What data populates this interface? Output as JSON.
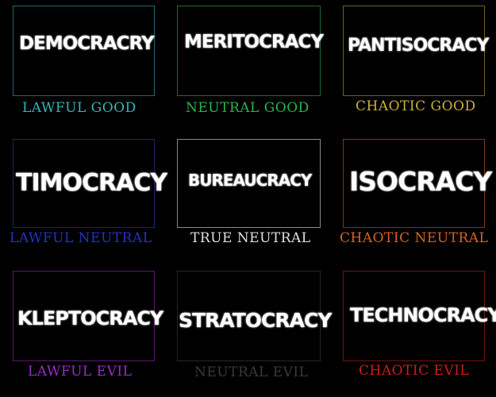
{
  "cells": [
    {
      "word": "DEMOCRACRY",
      "alignment": "LAWFUL GOOD",
      "color": "#2fb7b7",
      "border": "#1e6b6b"
    },
    {
      "word": "MERITOCRACY",
      "alignment": "NEUTRAL GOOD",
      "color": "#28b54a",
      "border": "#1c6a30"
    },
    {
      "word": "PANTISOCRACY",
      "alignment": "CHAOTIC GOOD",
      "color": "#c9b13a",
      "border": "#6e6323"
    },
    {
      "word": "TIMOCRACY",
      "alignment": "LAWFUL NEUTRAL",
      "color": "#2233c4",
      "border": "#1a2470"
    },
    {
      "word": "BUREAUCRACY",
      "alignment": "TRUE NEUTRAL",
      "color": "#e0e0e0",
      "border": "#8a8a8a"
    },
    {
      "word": "ISOCRACY",
      "alignment": "CHAOTIC NEUTRAL",
      "color": "#d9621c",
      "border": "#7a3a14"
    },
    {
      "word": "KLEPTOCRACY",
      "alignment": "LAWFUL EVIL",
      "color": "#9a2cc4",
      "border": "#5a1a72"
    },
    {
      "word": "STRATOCRACY",
      "alignment": "NEUTRAL EVIL",
      "color": "#3a3a3a",
      "border": "#262626"
    },
    {
      "word": "TECHNOCRACY",
      "alignment": "CHAOTIC EVIL",
      "color": "#d11a1a",
      "border": "#701212"
    }
  ]
}
